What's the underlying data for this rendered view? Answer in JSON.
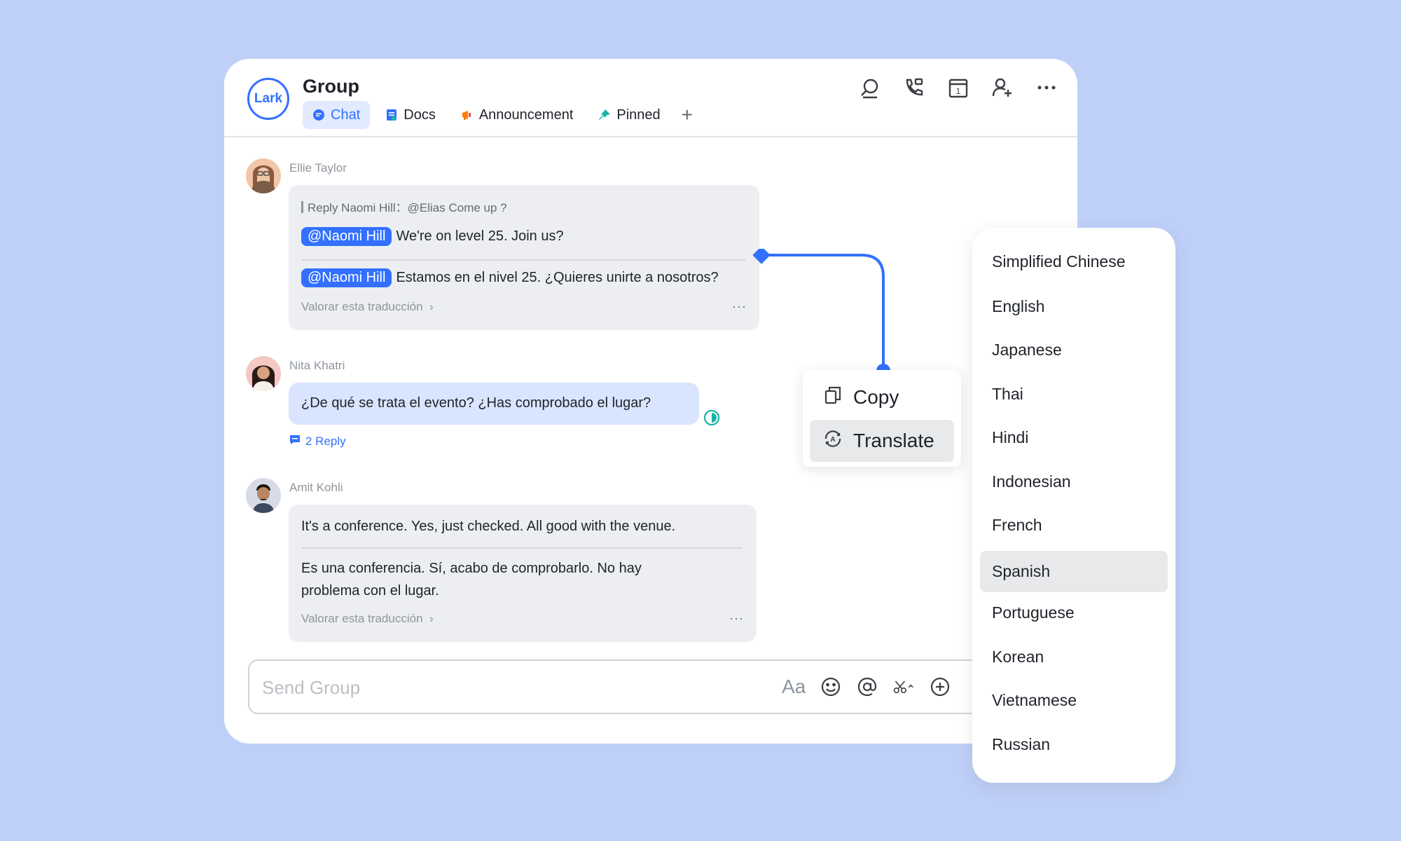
{
  "header": {
    "logo": "Lark",
    "title": "Group",
    "tabs": [
      {
        "label": "Chat",
        "icon": "chat-bubble-icon",
        "active": true
      },
      {
        "label": "Docs",
        "icon": "doc-icon",
        "active": false
      },
      {
        "label": "Announcement",
        "icon": "megaphone-icon",
        "active": false
      },
      {
        "label": "Pinned",
        "icon": "pin-icon",
        "active": false
      }
    ],
    "add_tab": "+",
    "actions": [
      "search-icon",
      "phone-icon",
      "calendar-icon",
      "add-member-icon",
      "more-icon"
    ],
    "calendar_day": "1"
  },
  "messages": [
    {
      "sender": "Ellie Taylor",
      "reply_prefix": "Reply Naomi Hill：",
      "reply_text": "@Elias Come up ?",
      "mention": "@Naomi Hill",
      "original": "We're on level 25. Join us?",
      "translation": "Estamos en el nivel 25. ¿Quieres unirte a nosotros?",
      "rate": "Valorar esta traducción",
      "more": "···"
    },
    {
      "sender": "Nita Khatri",
      "text": "¿De qué se trata el evento? ¿Has comprobado el lugar?",
      "reply_count": "2 Reply"
    },
    {
      "sender": "Amit Kohli",
      "original": "It's a conference. Yes, just checked. All good with the venue.",
      "translation_line1": "Es una conferencia. Sí, acabo de comprobarlo. No hay",
      "translation_line2": "problema con el lugar.",
      "rate": "Valorar esta traducción",
      "more": "···"
    }
  ],
  "composer": {
    "placeholder": "Send Group",
    "font_tool": "Aa"
  },
  "context_menu": {
    "items": [
      {
        "label": "Copy",
        "icon": "copy-icon",
        "active": false
      },
      {
        "label": "Translate",
        "icon": "translate-icon",
        "active": true
      }
    ]
  },
  "languages": {
    "selected": "Spanish",
    "items": [
      "Simplified Chinese",
      "English",
      "Japanese",
      "Thai",
      "Hindi",
      "Indonesian",
      "French",
      "Spanish",
      "Portuguese",
      "Korean",
      "Vietnamese",
      "Russian"
    ]
  },
  "colors": {
    "accent": "#3370ff",
    "background": "#bfd0f8",
    "bubble": "#eceef1",
    "bubble_blue": "#d9e5ff"
  }
}
